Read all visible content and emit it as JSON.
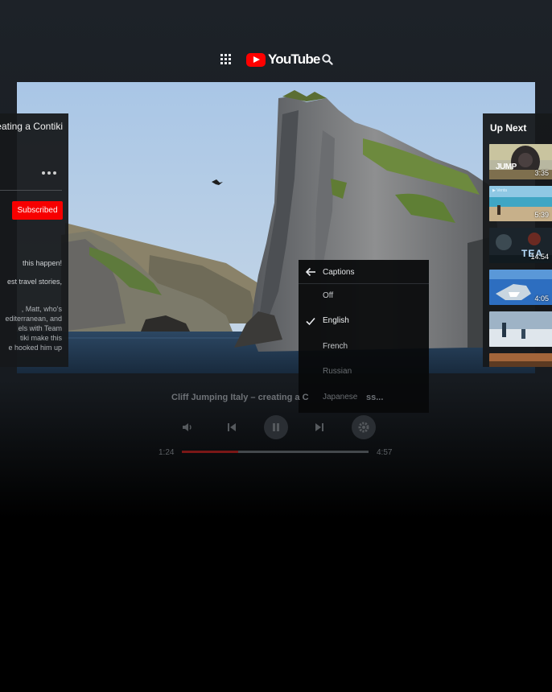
{
  "app": {
    "logo_text": "YouTube",
    "brand_color": "#ff0000"
  },
  "info_panel": {
    "title": "Cliff Jumping Italy – creating a Contiki",
    "subscribe_label": "Subscribed",
    "description_lines": [
      "this happen!",
      "est travel stories,",
      ", Matt, who's",
      "editerranean, and",
      "els with Team",
      "tiki make this",
      "e hooked him up"
    ]
  },
  "up_next": {
    "title": "Up Next",
    "items": [
      {
        "thumb": "gorilla-jump",
        "overlay": "JUMP",
        "duration": "3:35"
      },
      {
        "thumb": "beach",
        "overlay": "▶ Venta",
        "duration": "5:39"
      },
      {
        "thumb": "teaser-trailer",
        "overlay": "TEA",
        "duration": "14:54"
      },
      {
        "thumb": "shark",
        "overlay": "",
        "duration": "4:05"
      },
      {
        "thumb": "snow-hikers",
        "overlay": "",
        "duration": ""
      },
      {
        "thumb": "partial",
        "overlay": "",
        "duration": ""
      }
    ]
  },
  "captions_menu": {
    "title": "Captions",
    "options": [
      {
        "label": "Off",
        "selected": false
      },
      {
        "label": "English",
        "selected": true
      },
      {
        "label": "French",
        "selected": false
      },
      {
        "label": "Russian",
        "selected": false
      },
      {
        "label": "Japanese",
        "selected": false
      }
    ]
  },
  "player": {
    "now_playing_title": "Cliff Jumping Italy – creating a C",
    "now_playing_title_tail": "ss...",
    "current_time": "1:24",
    "total_time": "4:57",
    "progress_fraction": 0.3,
    "progress_color": "#7a1717"
  },
  "icons": [
    "apps-icon",
    "search-icon",
    "more-icon",
    "back-arrow-icon",
    "check-icon",
    "volume-icon",
    "previous-icon",
    "pause-icon",
    "next-icon",
    "settings-icon"
  ]
}
